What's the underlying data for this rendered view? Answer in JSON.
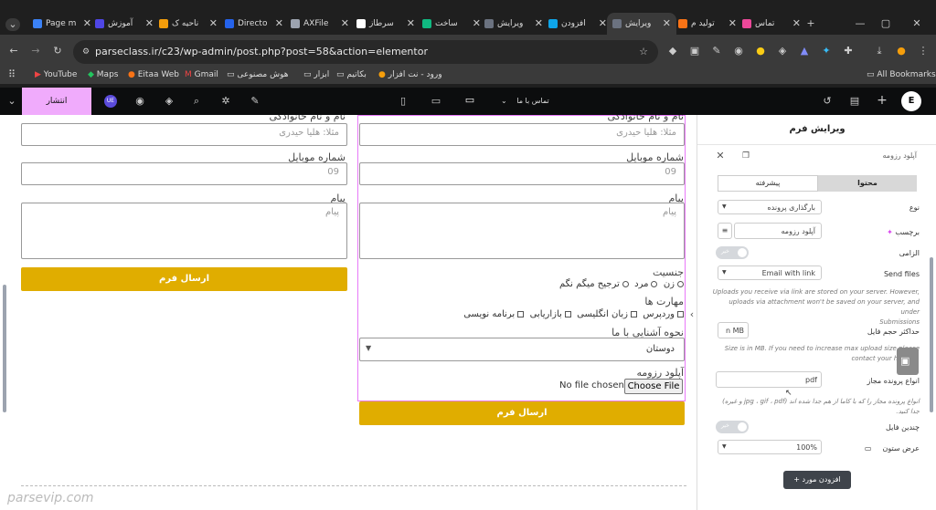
{
  "browser": {
    "tabs": [
      {
        "title": "Page m",
        "color": "#3b82f6"
      },
      {
        "title": "آموزش",
        "color": "#4f46e5"
      },
      {
        "title": "ناحیه ک",
        "color": "#f59e0b"
      },
      {
        "title": "Directo",
        "color": "#2563eb"
      },
      {
        "title": "AXFile",
        "color": "#9ca3af"
      },
      {
        "title": "سرطاز",
        "color": "#ffffff"
      },
      {
        "title": "ساخت",
        "color": "#10b981"
      },
      {
        "title": "ویرایش",
        "color": "#6b7280"
      },
      {
        "title": "افزودن",
        "color": "#0ea5e9"
      },
      {
        "title": "ویرایش",
        "color": "#6b7280"
      },
      {
        "title": "تولید م",
        "color": "#f97316"
      },
      {
        "title": "تماس",
        "color": "#ec4899"
      }
    ],
    "url": "parseclass.ir/c23/wp-admin/post.php?post=58&action=elementor",
    "bookmarks": [
      "YouTube",
      "Maps",
      "Eitaa Web",
      "Gmail",
      "هوش مصنوعی",
      "ابزار",
      "بکاتیم",
      "ورود - نت افزار",
      "All Bookmarks"
    ]
  },
  "editor_top": {
    "publish_label": "انتشار",
    "page_label": "تماس با ما",
    "avatar_text": "UE"
  },
  "form_left": {
    "name_label": "نام و نام خانوادگی",
    "name_placeholder": "مثلا: هلیا حیدری",
    "mobile_label": "شماره موبایل",
    "mobile_placeholder": "09",
    "message_label": "پیام",
    "message_placeholder": "پیام",
    "submit_label": "ارسال فرم"
  },
  "form_right": {
    "name_label": "نام و نام خانوادگی",
    "name_placeholder": "مثلا: هلیا حیدری",
    "mobile_label": "شماره موبایل",
    "mobile_placeholder": "09",
    "message_label": "پیام",
    "message_placeholder": "پیام",
    "gender_label": "جنسیت",
    "gender_options": [
      "زن",
      "مرد",
      "ترجیح میگم نگم"
    ],
    "skills_label": "مهارت ها",
    "skills_options": [
      "وردپرس",
      "زبان انگلیسی",
      "بازاریابی",
      "برنامه نویسی"
    ],
    "referral_label": "نحوه آشنایی با ما",
    "referral_value": "دوستان",
    "upload_label": "آپلود رزومه",
    "choose_file": "Choose File",
    "no_file": "No file chosen",
    "submit_label": "ارسال فرم"
  },
  "watermark": "parsevip.com",
  "panel": {
    "title": "ویرایش فرم",
    "field_item": "آپلود رزومه",
    "tab_content": "محتوا",
    "tab_advanced": "پیشرفته",
    "type_label": "نوع",
    "type_value": "بارگذاری پرونده",
    "label_label": "برچسب",
    "label_value": "آپلود رزومه",
    "required_label": "الزامی",
    "toggle_off": "خیر",
    "send_files_label": "Send files",
    "send_files_value": "Email with link",
    "send_files_hint_1": "Uploads you receive via link are stored on your server. However,",
    "send_files_hint_2": "uploads via attachment won't be saved on your server, and under",
    "send_files_hint_3": "Submissions",
    "max_size_label": "حداکثر حجم فایل",
    "max_size_value": "n MB",
    "max_size_hint_1": "Size is in MB. If you need to increase max upload size please",
    "max_size_hint_2": "contact your hosting.",
    "file_types_label": "انواع پرونده مجاز",
    "file_types_value": "pdf",
    "file_types_hint_1": "انواع پرونده مجاز را که با کاما از هم جدا شده اند (jpg ، gif ، pdf و غیره)",
    "file_types_hint_2": "جدا کنید.",
    "multiple_label": "چندین فایل",
    "width_label": "عرض ستون",
    "width_value": "100%",
    "add_item": "افزودن مورد"
  }
}
